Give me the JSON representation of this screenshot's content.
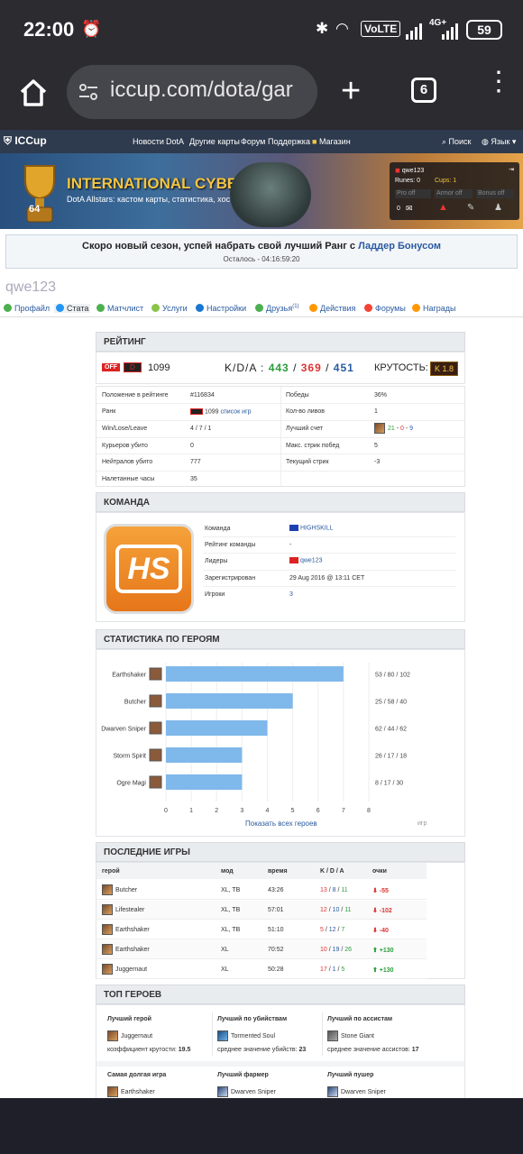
{
  "status_bar": {
    "time": "22:00",
    "volte": "VoLTE",
    "network": "4G+",
    "battery": "59"
  },
  "browser": {
    "url": "iccup.com/dota/gar",
    "tabs_count": "6"
  },
  "nav": {
    "logo": "ICCup",
    "links": [
      "Новости",
      "DotA",
      "Другие карты",
      "Форум",
      "Поддержка",
      "Магазин"
    ],
    "search": "Поиск",
    "language": "Язык"
  },
  "banner": {
    "title": "INTERNATIONAL CYBER CUP",
    "subtitle": "DotA Allstars: кастом карты, статистика, хост-боты",
    "cup_number": "64",
    "panel": {
      "user": "qwe123",
      "runes": "Runes: 0",
      "cups": "Cups: 1",
      "f1": "Pro off",
      "f2": "Armor off",
      "f3": "Bonus off",
      "mail": "0"
    }
  },
  "announce": {
    "text": "Скоро новый сезон, успей набрать свой лучший Ранг с ",
    "link": "Ладдер Бонусом",
    "timer": "Осталось - 04:16:59:20"
  },
  "username": "qwe123",
  "tabs": [
    {
      "label": "Профайл",
      "color": "#4caf50"
    },
    {
      "label": "Стата",
      "color": "#2196f3"
    },
    {
      "label": "Матчлист",
      "color": "#4caf50"
    },
    {
      "label": "Услуги",
      "color": "#8bc34a"
    },
    {
      "label": "Настройки",
      "color": "#1976d2"
    },
    {
      "label": "Друзья",
      "color": "#4caf50",
      "sup": "(1)"
    },
    {
      "label": "Действия",
      "color": "#ff9800"
    },
    {
      "label": "Форумы",
      "color": "#f44336"
    },
    {
      "label": "Награды",
      "color": "#ff9800"
    }
  ],
  "rating": {
    "heading": "РЕЙТИНГ",
    "off": "OFF",
    "badge": "D",
    "score": "1099",
    "kda_label": "K/D/A :",
    "kills": "443",
    "deaths": "369",
    "assists": "451",
    "coolness_label": "КРУТОСТЬ:",
    "coolness_value": "K 1.8",
    "left_rows": [
      {
        "label": "Положение в рейтинге",
        "value": "#116834"
      },
      {
        "label": "Ранк",
        "value": "1099",
        "link": "список игр"
      },
      {
        "label": "Win/Lose/Leave",
        "value": "4 / 7 / 1"
      },
      {
        "label": "Курьеров убито",
        "value": "0"
      },
      {
        "label": "Нейтралов убито",
        "value": "777"
      },
      {
        "label": "Налетанные часы",
        "value": "35"
      }
    ],
    "right_rows": [
      {
        "label": "Победы",
        "value": "36%"
      },
      {
        "label": "Кол-во ливов",
        "value": "1"
      },
      {
        "label": "Лучший счет",
        "k": "21",
        "d": "0",
        "a": "9"
      },
      {
        "label": "Макс. стрик побед",
        "value": "5"
      },
      {
        "label": "Текущий стрик",
        "value": "-3"
      }
    ]
  },
  "team": {
    "heading": "КОМАНДА",
    "logo_text": "HS",
    "rows": [
      {
        "label": "Команда",
        "value": "HIGHSKILL"
      },
      {
        "label": "Рейтинг команды",
        "value": "-"
      },
      {
        "label": "Лидеры",
        "value": "qwe123"
      },
      {
        "label": "Зарегистрирован",
        "value": "29 Aug 2016 @ 13:11 CET"
      },
      {
        "label": "Игроки",
        "value": "3"
      }
    ]
  },
  "hero_stats": {
    "heading": "СТАТИСТИКА ПО ГЕРОЯМ",
    "show_all": "Показать всех героев",
    "games_label": "игр"
  },
  "chart_data": {
    "type": "bar",
    "orientation": "horizontal",
    "categories": [
      "Earthshaker",
      "Butcher",
      "Dwarven Sniper",
      "Storm Spirit",
      "Ogre Magi"
    ],
    "values": [
      7,
      5,
      4,
      3,
      3
    ],
    "kda": [
      "53 / 80 / 102",
      "25 / 58 / 40",
      "62 / 44 / 62",
      "26 / 17 / 18",
      "8 / 17 / 30"
    ],
    "xticks": [
      "0",
      "1",
      "2",
      "3",
      "4",
      "5",
      "6",
      "7",
      "8"
    ],
    "xlim": [
      0,
      8
    ],
    "xlabel": "игр",
    "bar_color": "#7fb8ea"
  },
  "recent": {
    "heading": "ПОСЛЕДНИЕ ИГРЫ",
    "cols": [
      "герой",
      "мод",
      "время",
      "K / D / A",
      "очки"
    ],
    "rows": [
      {
        "hero": "Butcher",
        "mode": "XL, TB",
        "time": "43:26",
        "k": "13",
        "d": "8",
        "a": "11",
        "pts": "-55",
        "up": false
      },
      {
        "hero": "Lifestealer",
        "mode": "XL, TB",
        "time": "57:01",
        "k": "12",
        "d": "10",
        "a": "11",
        "pts": "-102",
        "up": false
      },
      {
        "hero": "Earthshaker",
        "mode": "XL, TB",
        "time": "51:10",
        "k": "5",
        "d": "12",
        "a": "7",
        "pts": "-40",
        "up": false
      },
      {
        "hero": "Earthshaker",
        "mode": "XL",
        "time": "70:52",
        "k": "10",
        "d": "19",
        "a": "26",
        "pts": "+130",
        "up": true
      },
      {
        "hero": "Juggernaut",
        "mode": "XL",
        "time": "50:28",
        "k": "17",
        "d": "1",
        "a": "5",
        "pts": "+130",
        "up": true
      }
    ]
  },
  "top": {
    "heading": "ТОП ГЕРОЕВ",
    "items": [
      {
        "title": "Лучший герой",
        "hero": "Juggernaut",
        "desc": "коэффициент крутости:",
        "val": "19.5"
      },
      {
        "title": "Лучший по убийствам",
        "hero": "Tormented Soul",
        "desc": "среднее значение убийств:",
        "val": "23"
      },
      {
        "title": "Лучший по ассистам",
        "hero": "Stone Giant",
        "desc": "среднее значение ассистов:",
        "val": "17"
      },
      {
        "title": "Самая долгая игра",
        "hero": "Earthshaker"
      },
      {
        "title": "Лучший фармер",
        "hero": "Dwarven Sniper"
      },
      {
        "title": "Лучший пушер",
        "hero": "Dwarven Sniper"
      }
    ]
  }
}
